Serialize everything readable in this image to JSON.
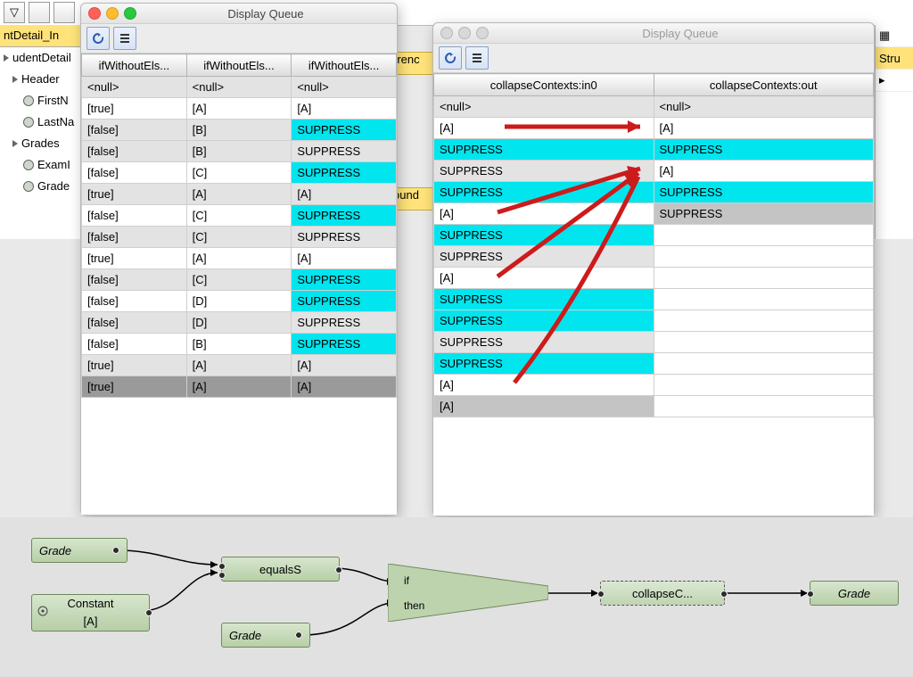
{
  "tabstrip": {
    "icon1": "▽"
  },
  "tree": {
    "toptab": "ntDetail_In",
    "rows": [
      "udentDetail",
      "Header",
      "FirstN",
      "LastNa",
      "Grades",
      "ExamI",
      "Grade"
    ]
  },
  "right": {
    "label": "Stru"
  },
  "win1": {
    "title": "Display Queue",
    "columns": [
      "ifWithoutEls...",
      "ifWithoutEls...",
      "ifWithoutEls..."
    ],
    "rows": [
      {
        "c": [
          "<null>",
          "<null>",
          "<null>"
        ],
        "s": [
          "g",
          "g",
          "g"
        ]
      },
      {
        "c": [
          "[true]",
          "[A]",
          "[A]"
        ],
        "s": [
          "w",
          "w",
          "w"
        ]
      },
      {
        "c": [
          "[false]",
          "[B]",
          "SUPPRESS"
        ],
        "s": [
          "g",
          "g",
          "c"
        ]
      },
      {
        "c": [
          "[false]",
          "[B]",
          "SUPPRESS"
        ],
        "s": [
          "g",
          "g",
          "g"
        ]
      },
      {
        "c": [
          "[false]",
          "[C]",
          "SUPPRESS"
        ],
        "s": [
          "w",
          "w",
          "c"
        ]
      },
      {
        "c": [
          "[true]",
          "[A]",
          "[A]"
        ],
        "s": [
          "g",
          "g",
          "g"
        ]
      },
      {
        "c": [
          "[false]",
          "[C]",
          "SUPPRESS"
        ],
        "s": [
          "w",
          "w",
          "c"
        ]
      },
      {
        "c": [
          "[false]",
          "[C]",
          "SUPPRESS"
        ],
        "s": [
          "g",
          "g",
          "g"
        ]
      },
      {
        "c": [
          "[true]",
          "[A]",
          "[A]"
        ],
        "s": [
          "w",
          "w",
          "w"
        ]
      },
      {
        "c": [
          "[false]",
          "[C]",
          "SUPPRESS"
        ],
        "s": [
          "g",
          "g",
          "c"
        ]
      },
      {
        "c": [
          "[false]",
          "[D]",
          "SUPPRESS"
        ],
        "s": [
          "w",
          "w",
          "c"
        ]
      },
      {
        "c": [
          "[false]",
          "[D]",
          "SUPPRESS"
        ],
        "s": [
          "g",
          "g",
          "g"
        ]
      },
      {
        "c": [
          "[false]",
          "[B]",
          "SUPPRESS"
        ],
        "s": [
          "w",
          "w",
          "c"
        ]
      },
      {
        "c": [
          "[true]",
          "[A]",
          "[A]"
        ],
        "s": [
          "g",
          "g",
          "g"
        ]
      },
      {
        "c": [
          "[true]",
          "[A]",
          "[A]"
        ],
        "s": [
          "d",
          "d",
          "d"
        ]
      }
    ]
  },
  "win2": {
    "title": "Display Queue",
    "columns": [
      "collapseContexts:in0",
      "collapseContexts:out"
    ],
    "rows": [
      {
        "c": [
          "<null>",
          "<null>"
        ],
        "s": [
          "g",
          "g"
        ]
      },
      {
        "c": [
          "[A]",
          "[A]"
        ],
        "s": [
          "w",
          "w"
        ]
      },
      {
        "c": [
          "SUPPRESS",
          "SUPPRESS"
        ],
        "s": [
          "c",
          "c"
        ]
      },
      {
        "c": [
          "SUPPRESS",
          "[A]"
        ],
        "s": [
          "g",
          "w"
        ]
      },
      {
        "c": [
          "SUPPRESS",
          "SUPPRESS"
        ],
        "s": [
          "c",
          "c"
        ]
      },
      {
        "c": [
          "[A]",
          "SUPPRESS"
        ],
        "s": [
          "w",
          "dg"
        ]
      },
      {
        "c": [
          "SUPPRESS",
          ""
        ],
        "s": [
          "c",
          "w"
        ]
      },
      {
        "c": [
          "SUPPRESS",
          ""
        ],
        "s": [
          "g",
          "w"
        ]
      },
      {
        "c": [
          "[A]",
          ""
        ],
        "s": [
          "w",
          "w"
        ]
      },
      {
        "c": [
          "SUPPRESS",
          ""
        ],
        "s": [
          "c",
          "w"
        ]
      },
      {
        "c": [
          "SUPPRESS",
          ""
        ],
        "s": [
          "c",
          "w"
        ]
      },
      {
        "c": [
          "SUPPRESS",
          ""
        ],
        "s": [
          "g",
          "w"
        ]
      },
      {
        "c": [
          "SUPPRESS",
          ""
        ],
        "s": [
          "c",
          "w"
        ]
      },
      {
        "c": [
          "[A]",
          ""
        ],
        "s": [
          "w",
          "w"
        ]
      },
      {
        "c": [
          "[A]",
          ""
        ],
        "s": [
          "dg",
          "w"
        ]
      }
    ]
  },
  "diagram": {
    "grade1": "Grade",
    "constant": "Constant",
    "constant2": "[A]",
    "equalsS": "equalsS",
    "grade2": "Grade",
    "if": "if",
    "then": "then",
    "collapse": "collapseC...",
    "gradeOut": "Grade"
  },
  "bg": {
    "rrenc": "rrenc",
    "ound": "ound"
  }
}
